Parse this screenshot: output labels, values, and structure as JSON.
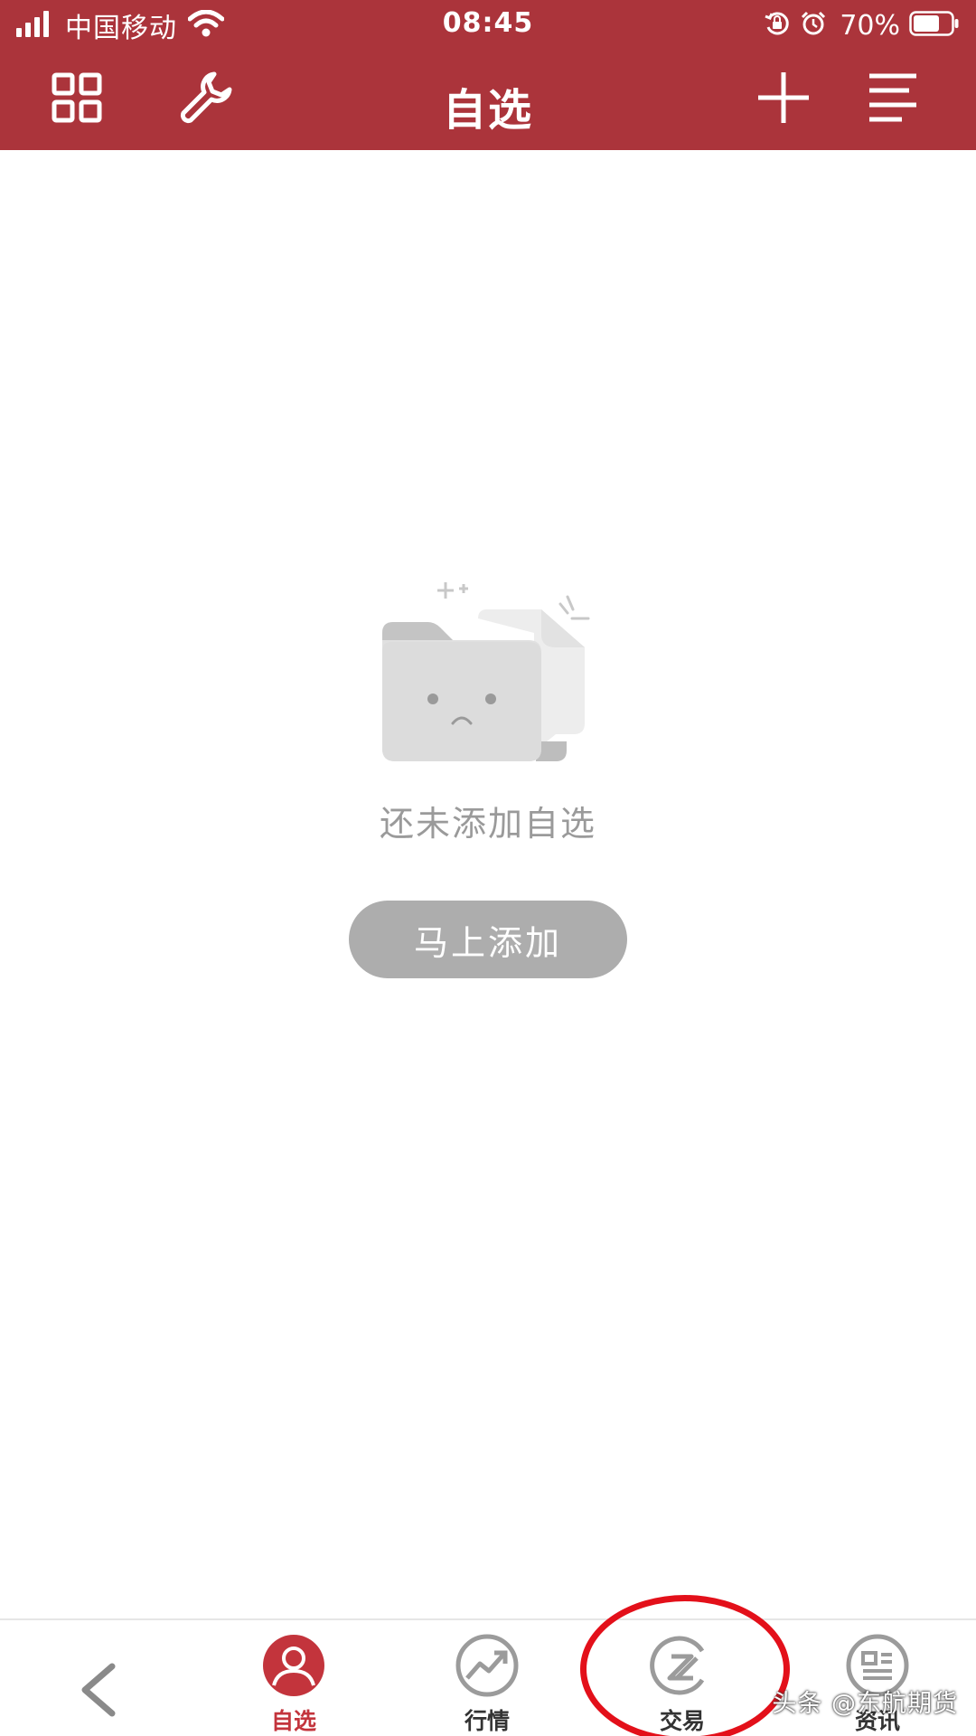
{
  "status_bar": {
    "carrier": "中国移动",
    "time": "08:45",
    "battery": "70%",
    "battery_level": 0.7
  },
  "nav": {
    "title": "自选",
    "left_icons": [
      "grid-icon",
      "wrench-icon"
    ],
    "right_icons": [
      "plus-icon",
      "menu-icon"
    ]
  },
  "empty_state": {
    "illustration": "empty-folder-icon",
    "message": "还未添加自选",
    "button_label": "马上添加"
  },
  "tab_bar": {
    "back_icon": "chevron-left-icon",
    "tabs": [
      {
        "label": "自选",
        "icon": "user-icon",
        "active": true
      },
      {
        "label": "行情",
        "icon": "trend-chart-icon",
        "active": false
      },
      {
        "label": "交易",
        "icon": "trade-icon",
        "active": false
      },
      {
        "label": "资讯",
        "icon": "news-icon",
        "active": false
      }
    ]
  },
  "watermark": "头条 @东航期货",
  "colors": {
    "brand": "#ab343b",
    "active_tab": "#c3343c",
    "annotation": "#e3101a",
    "button_gray": "#adadad"
  }
}
